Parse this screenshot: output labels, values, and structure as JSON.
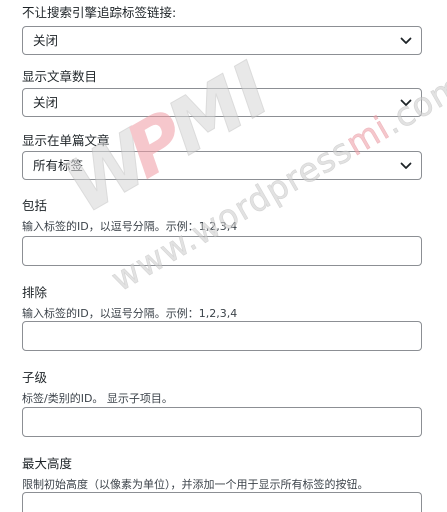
{
  "fields": {
    "nofollow": {
      "label": "不让搜索引擎追踪标签链接:",
      "selected": "关闭"
    },
    "show_count": {
      "label": "显示文章数目",
      "selected": "关闭"
    },
    "show_on_single": {
      "label": "显示在单篇文章",
      "selected": "所有标签"
    },
    "include": {
      "label": "包括",
      "description": "输入标签的ID，以逗号分隔。示例：1,2,3,4",
      "value": ""
    },
    "exclude": {
      "label": "排除",
      "description": "输入标签的ID，以逗号分隔。示例：1,2,3,4",
      "value": ""
    },
    "child_of": {
      "label": "子级",
      "description": "标签/类别的ID。 显示子项目。",
      "value": ""
    },
    "max_height": {
      "label": "最大高度",
      "description": "限制初始高度（以像素为单位），并添加一个用于显示所有标签的按钮。",
      "value": ""
    }
  },
  "watermark": {
    "logo": "WPMI",
    "url": "www.wordpressmi.com"
  },
  "colors": {
    "border": "#8c8f94",
    "text": "#1d2327",
    "watermark_red": "#e8a0a6",
    "watermark_gray": "#c9c9c9"
  }
}
